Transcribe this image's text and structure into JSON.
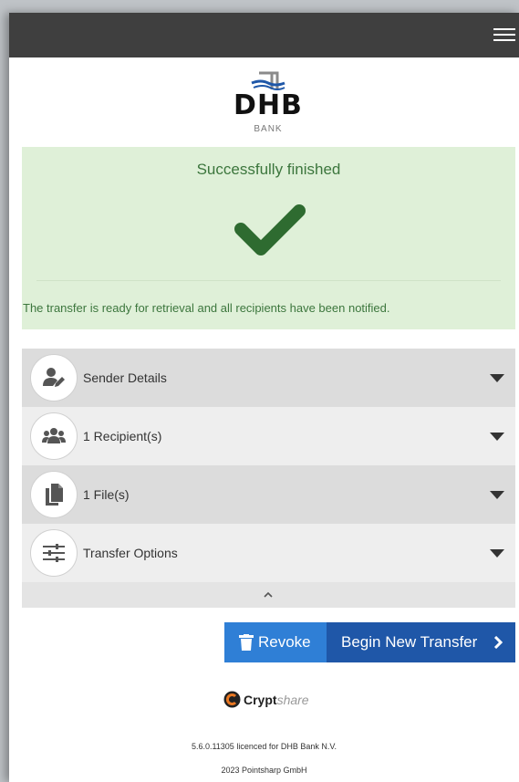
{
  "header": {
    "menu_icon": "hamburger-icon"
  },
  "logo": {
    "text": "DHB",
    "subtext": "BANK"
  },
  "success": {
    "title": "Successfully finished",
    "icon": "checkmark-icon",
    "message": "The transfer is ready for retrieval and all recipients have been notified."
  },
  "accordion": {
    "items": [
      {
        "label": "Sender Details",
        "icon": "user-edit-icon"
      },
      {
        "label": "1 Recipient(s)",
        "icon": "users-icon"
      },
      {
        "label": "1 File(s)",
        "icon": "files-icon"
      },
      {
        "label": "Transfer Options",
        "icon": "sliders-icon"
      }
    ],
    "collapse_icon": "chevron-up-icon"
  },
  "actions": {
    "revoke_label": "Revoke",
    "new_transfer_label": "Begin New Transfer"
  },
  "footer": {
    "brand_bold": "Crypt",
    "brand_light": "share",
    "version": "5.6.0.11305 licenced for DHB Bank N.V.",
    "copyright": "2023 Pointsharp GmbH"
  },
  "colors": {
    "topbar": "#3f3f3f",
    "success_bg": "#dff0d8",
    "success_text": "#3c763d",
    "checkmark": "#2e6b30",
    "revoke_button": "#2f7fd6",
    "new_transfer_button": "#1f57a8"
  }
}
